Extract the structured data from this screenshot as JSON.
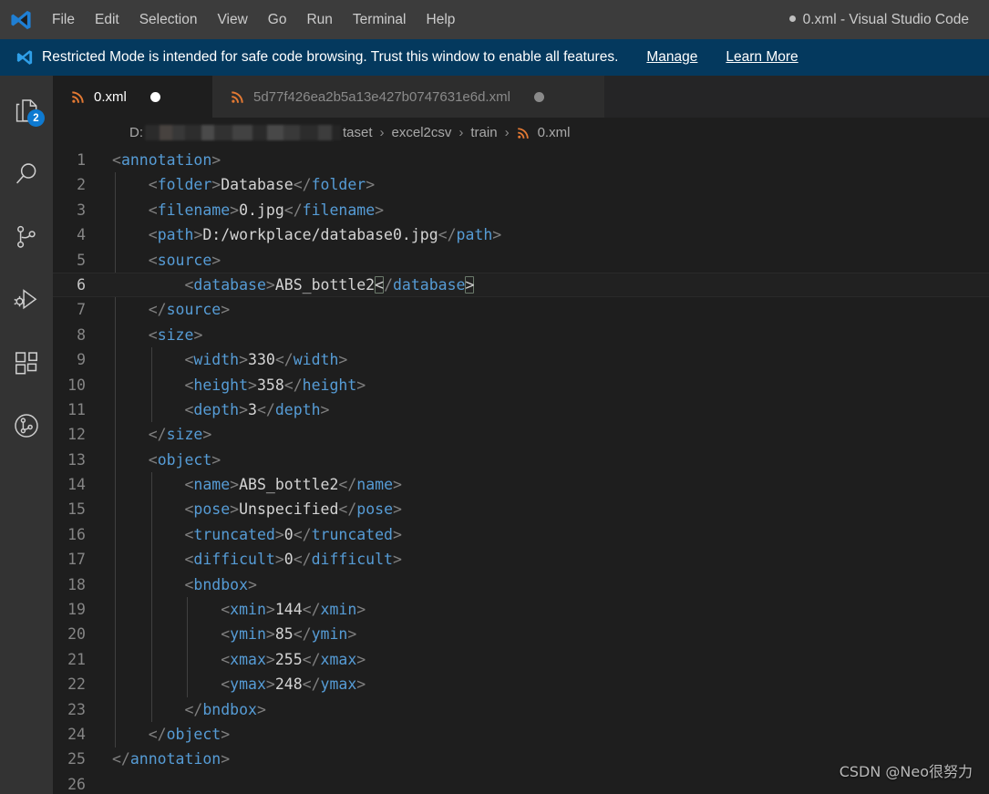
{
  "titlebar": {
    "logo_icon": "vscode-logo-icon",
    "menus": [
      "File",
      "Edit",
      "Selection",
      "View",
      "Go",
      "Run",
      "Terminal",
      "Help"
    ],
    "window_title": "0.xml - Visual Studio Code",
    "dirty_indicator": "●"
  },
  "banner": {
    "icon": "vscode-shield-icon",
    "message": "Restricted Mode is intended for safe code browsing. Trust this window to enable all features.",
    "manage_label": "Manage",
    "learn_more_label": "Learn More",
    "background_color": "#04395e"
  },
  "activitybar": {
    "items": [
      {
        "name": "explorer",
        "icon": "files-icon",
        "badge": "2"
      },
      {
        "name": "search",
        "icon": "search-icon",
        "badge": ""
      },
      {
        "name": "source-control",
        "icon": "source-control-icon",
        "badge": ""
      },
      {
        "name": "run-and-debug",
        "icon": "run-debug-icon",
        "badge": ""
      },
      {
        "name": "extensions",
        "icon": "extensions-icon",
        "badge": ""
      },
      {
        "name": "testing",
        "icon": "git-graph-icon",
        "badge": ""
      }
    ],
    "badge_color": "#0e7ad1"
  },
  "tabs": [
    {
      "label": "0.xml",
      "icon": "xml-file-icon",
      "active": true,
      "dirty": true
    },
    {
      "label": "5d77f426ea2b5a13e427b0747631e6d.xml",
      "icon": "xml-file-icon",
      "active": false,
      "dirty": true
    }
  ],
  "breadcrumb": {
    "drive": "D:",
    "redacted": true,
    "segments": [
      "taset",
      "excel2csv",
      "train"
    ],
    "file_icon": "xml-file-icon",
    "file": "0.xml",
    "separator": "›"
  },
  "editor": {
    "language": "xml",
    "current_line": 6,
    "total_lines_visible": 26,
    "lines": [
      {
        "n": 1,
        "indent": 0,
        "tokens": [
          {
            "t": "br",
            "v": "<"
          },
          {
            "t": "tag",
            "v": "annotation"
          },
          {
            "t": "br",
            "v": ">"
          }
        ]
      },
      {
        "n": 2,
        "indent": 1,
        "tokens": [
          {
            "t": "br",
            "v": "<"
          },
          {
            "t": "tag",
            "v": "folder"
          },
          {
            "t": "br",
            "v": ">"
          },
          {
            "t": "txt",
            "v": "Database"
          },
          {
            "t": "br",
            "v": "</"
          },
          {
            "t": "tag",
            "v": "folder"
          },
          {
            "t": "br",
            "v": ">"
          }
        ]
      },
      {
        "n": 3,
        "indent": 1,
        "tokens": [
          {
            "t": "br",
            "v": "<"
          },
          {
            "t": "tag",
            "v": "filename"
          },
          {
            "t": "br",
            "v": ">"
          },
          {
            "t": "txt",
            "v": "0.jpg"
          },
          {
            "t": "br",
            "v": "</"
          },
          {
            "t": "tag",
            "v": "filename"
          },
          {
            "t": "br",
            "v": ">"
          }
        ]
      },
      {
        "n": 4,
        "indent": 1,
        "tokens": [
          {
            "t": "br",
            "v": "<"
          },
          {
            "t": "tag",
            "v": "path"
          },
          {
            "t": "br",
            "v": ">"
          },
          {
            "t": "txt",
            "v": "D:/workplace/database0.jpg"
          },
          {
            "t": "br",
            "v": "</"
          },
          {
            "t": "tag",
            "v": "path"
          },
          {
            "t": "br",
            "v": ">"
          }
        ]
      },
      {
        "n": 5,
        "indent": 1,
        "tokens": [
          {
            "t": "br",
            "v": "<"
          },
          {
            "t": "tag",
            "v": "source"
          },
          {
            "t": "br",
            "v": ">"
          }
        ]
      },
      {
        "n": 6,
        "indent": 2,
        "tokens": [
          {
            "t": "br",
            "v": "<"
          },
          {
            "t": "tag",
            "v": "database"
          },
          {
            "t": "br",
            "v": ">"
          },
          {
            "t": "txt",
            "v": "ABS_bottle2"
          },
          {
            "t": "match",
            "v": "<"
          },
          {
            "t": "br",
            "v": "/"
          },
          {
            "t": "tag",
            "v": "database"
          },
          {
            "t": "match",
            "v": ">"
          }
        ]
      },
      {
        "n": 7,
        "indent": 1,
        "tokens": [
          {
            "t": "br",
            "v": "</"
          },
          {
            "t": "tag",
            "v": "source"
          },
          {
            "t": "br",
            "v": ">"
          }
        ]
      },
      {
        "n": 8,
        "indent": 1,
        "tokens": [
          {
            "t": "br",
            "v": "<"
          },
          {
            "t": "tag",
            "v": "size"
          },
          {
            "t": "br",
            "v": ">"
          }
        ]
      },
      {
        "n": 9,
        "indent": 2,
        "tokens": [
          {
            "t": "br",
            "v": "<"
          },
          {
            "t": "tag",
            "v": "width"
          },
          {
            "t": "br",
            "v": ">"
          },
          {
            "t": "txt",
            "v": "330"
          },
          {
            "t": "br",
            "v": "</"
          },
          {
            "t": "tag",
            "v": "width"
          },
          {
            "t": "br",
            "v": ">"
          }
        ]
      },
      {
        "n": 10,
        "indent": 2,
        "tokens": [
          {
            "t": "br",
            "v": "<"
          },
          {
            "t": "tag",
            "v": "height"
          },
          {
            "t": "br",
            "v": ">"
          },
          {
            "t": "txt",
            "v": "358"
          },
          {
            "t": "br",
            "v": "</"
          },
          {
            "t": "tag",
            "v": "height"
          },
          {
            "t": "br",
            "v": ">"
          }
        ]
      },
      {
        "n": 11,
        "indent": 2,
        "tokens": [
          {
            "t": "br",
            "v": "<"
          },
          {
            "t": "tag",
            "v": "depth"
          },
          {
            "t": "br",
            "v": ">"
          },
          {
            "t": "txt",
            "v": "3"
          },
          {
            "t": "br",
            "v": "</"
          },
          {
            "t": "tag",
            "v": "depth"
          },
          {
            "t": "br",
            "v": ">"
          }
        ]
      },
      {
        "n": 12,
        "indent": 1,
        "tokens": [
          {
            "t": "br",
            "v": "</"
          },
          {
            "t": "tag",
            "v": "size"
          },
          {
            "t": "br",
            "v": ">"
          }
        ]
      },
      {
        "n": 13,
        "indent": 1,
        "tokens": [
          {
            "t": "br",
            "v": "<"
          },
          {
            "t": "tag",
            "v": "object"
          },
          {
            "t": "br",
            "v": ">"
          }
        ]
      },
      {
        "n": 14,
        "indent": 2,
        "tokens": [
          {
            "t": "br",
            "v": "<"
          },
          {
            "t": "tag",
            "v": "name"
          },
          {
            "t": "br",
            "v": ">"
          },
          {
            "t": "txt",
            "v": "ABS_bottle2"
          },
          {
            "t": "br",
            "v": "</"
          },
          {
            "t": "tag",
            "v": "name"
          },
          {
            "t": "br",
            "v": ">"
          }
        ]
      },
      {
        "n": 15,
        "indent": 2,
        "tokens": [
          {
            "t": "br",
            "v": "<"
          },
          {
            "t": "tag",
            "v": "pose"
          },
          {
            "t": "br",
            "v": ">"
          },
          {
            "t": "txt",
            "v": "Unspecified"
          },
          {
            "t": "br",
            "v": "</"
          },
          {
            "t": "tag",
            "v": "pose"
          },
          {
            "t": "br",
            "v": ">"
          }
        ]
      },
      {
        "n": 16,
        "indent": 2,
        "tokens": [
          {
            "t": "br",
            "v": "<"
          },
          {
            "t": "tag",
            "v": "truncated"
          },
          {
            "t": "br",
            "v": ">"
          },
          {
            "t": "txt",
            "v": "0"
          },
          {
            "t": "br",
            "v": "</"
          },
          {
            "t": "tag",
            "v": "truncated"
          },
          {
            "t": "br",
            "v": ">"
          }
        ]
      },
      {
        "n": 17,
        "indent": 2,
        "tokens": [
          {
            "t": "br",
            "v": "<"
          },
          {
            "t": "tag",
            "v": "difficult"
          },
          {
            "t": "br",
            "v": ">"
          },
          {
            "t": "txt",
            "v": "0"
          },
          {
            "t": "br",
            "v": "</"
          },
          {
            "t": "tag",
            "v": "difficult"
          },
          {
            "t": "br",
            "v": ">"
          }
        ]
      },
      {
        "n": 18,
        "indent": 2,
        "tokens": [
          {
            "t": "br",
            "v": "<"
          },
          {
            "t": "tag",
            "v": "bndbox"
          },
          {
            "t": "br",
            "v": ">"
          }
        ]
      },
      {
        "n": 19,
        "indent": 3,
        "tokens": [
          {
            "t": "br",
            "v": "<"
          },
          {
            "t": "tag",
            "v": "xmin"
          },
          {
            "t": "br",
            "v": ">"
          },
          {
            "t": "txt",
            "v": "144"
          },
          {
            "t": "br",
            "v": "</"
          },
          {
            "t": "tag",
            "v": "xmin"
          },
          {
            "t": "br",
            "v": ">"
          }
        ]
      },
      {
        "n": 20,
        "indent": 3,
        "tokens": [
          {
            "t": "br",
            "v": "<"
          },
          {
            "t": "tag",
            "v": "ymin"
          },
          {
            "t": "br",
            "v": ">"
          },
          {
            "t": "txt",
            "v": "85"
          },
          {
            "t": "br",
            "v": "</"
          },
          {
            "t": "tag",
            "v": "ymin"
          },
          {
            "t": "br",
            "v": ">"
          }
        ]
      },
      {
        "n": 21,
        "indent": 3,
        "tokens": [
          {
            "t": "br",
            "v": "<"
          },
          {
            "t": "tag",
            "v": "xmax"
          },
          {
            "t": "br",
            "v": ">"
          },
          {
            "t": "txt",
            "v": "255"
          },
          {
            "t": "br",
            "v": "</"
          },
          {
            "t": "tag",
            "v": "xmax"
          },
          {
            "t": "br",
            "v": ">"
          }
        ]
      },
      {
        "n": 22,
        "indent": 3,
        "tokens": [
          {
            "t": "br",
            "v": "<"
          },
          {
            "t": "tag",
            "v": "ymax"
          },
          {
            "t": "br",
            "v": ">"
          },
          {
            "t": "txt",
            "v": "248"
          },
          {
            "t": "br",
            "v": "</"
          },
          {
            "t": "tag",
            "v": "ymax"
          },
          {
            "t": "br",
            "v": ">"
          }
        ]
      },
      {
        "n": 23,
        "indent": 2,
        "tokens": [
          {
            "t": "br",
            "v": "</"
          },
          {
            "t": "tag",
            "v": "bndbox"
          },
          {
            "t": "br",
            "v": ">"
          }
        ]
      },
      {
        "n": 24,
        "indent": 1,
        "tokens": [
          {
            "t": "br",
            "v": "</"
          },
          {
            "t": "tag",
            "v": "object"
          },
          {
            "t": "br",
            "v": ">"
          }
        ]
      },
      {
        "n": 25,
        "indent": 0,
        "tokens": [
          {
            "t": "br",
            "v": "</"
          },
          {
            "t": "tag",
            "v": "annotation"
          },
          {
            "t": "br",
            "v": ">"
          }
        ]
      },
      {
        "n": 26,
        "indent": 0,
        "tokens": []
      }
    ]
  },
  "watermark": "CSDN @Neo很努力",
  "theme": {
    "editor_bg": "#1e1e1e",
    "titlebar_bg": "#3c3c3c",
    "activitybar_bg": "#333333",
    "tabsbar_bg": "#252526",
    "tag_color": "#569cd6",
    "bracket_color": "#808080",
    "text_color": "#d4d4d4",
    "xml_icon_color": "#e37933"
  }
}
